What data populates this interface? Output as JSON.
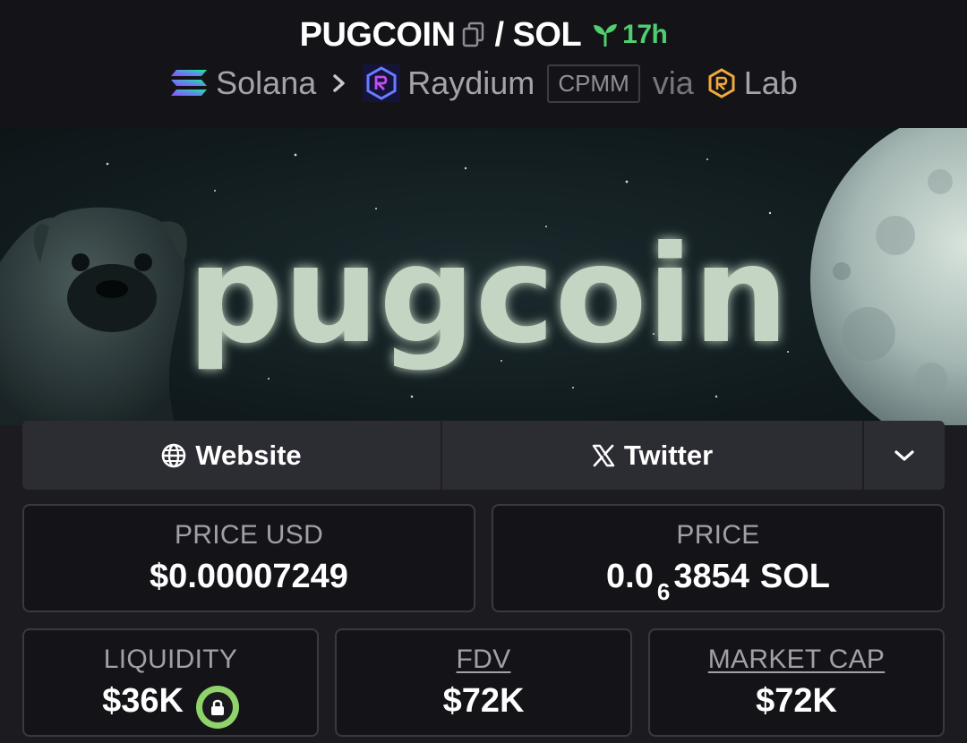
{
  "header": {
    "token": "PUGCOIN",
    "slash": "/",
    "quote": "SOL",
    "age": "17h",
    "chain": "Solana",
    "dex": "Raydium",
    "pool_type": "CPMM",
    "via": "via",
    "launchpad": "Lab"
  },
  "banner": {
    "text": "pugcoin"
  },
  "links": {
    "website": "Website",
    "twitter": "Twitter"
  },
  "stats": {
    "price_usd": {
      "label": "PRICE USD",
      "value": "$0.00007249"
    },
    "price": {
      "label": "PRICE",
      "prefix": "0.0",
      "zeros": "6",
      "digits": "3854",
      "unit": "SOL"
    },
    "liquidity": {
      "label": "LIQUIDITY",
      "value": "$36K"
    },
    "fdv": {
      "label": "FDV",
      "value": "$72K"
    },
    "market_cap": {
      "label": "MARKET CAP",
      "value": "$72K"
    }
  },
  "colors": {
    "age_green": "#4fce6f",
    "lock_green": "#8fd36a",
    "background": "#1c1c20"
  },
  "icons": [
    "copy-icon",
    "sprout-icon",
    "solana-logo-icon",
    "chevron-right-icon",
    "raydium-logo-icon",
    "raydium-lab-logo-icon",
    "globe-icon",
    "x-logo-icon",
    "chevron-down-icon",
    "lock-icon"
  ]
}
